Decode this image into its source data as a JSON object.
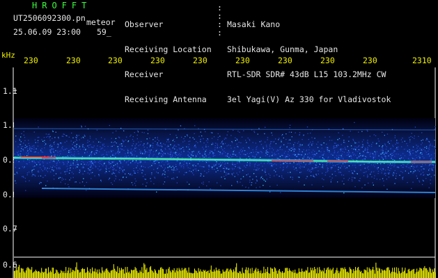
{
  "header": {
    "app_title": "HROFFT",
    "file_name": "UT2506092300.pn",
    "meteor_label": "meteor",
    "date_time": "25.06.09 23:00",
    "count": "59_",
    "info": [
      {
        "label": "Observer",
        "value": "Masaki Kano"
      },
      {
        "label": "Receiving Location",
        "value": "Shibukawa, Gunma, Japan"
      },
      {
        "label": "Receiver",
        "value": "RTL-SDR SDR# 43dB L15 103.2MHz CW"
      },
      {
        "label": "Receiving Antenna",
        "value": "3el Yagi(V) Az 330 for Vladivostok"
      }
    ]
  },
  "axis": {
    "unit": "kHz",
    "top_ticks": [
      "230",
      "230",
      "230",
      "230",
      "230",
      "230",
      "230",
      "230",
      "230",
      "2310"
    ],
    "y_ticks": [
      "1.1",
      "1.0",
      "0.9",
      "0.8",
      "0.7",
      "0.6"
    ]
  },
  "colors": {
    "text_green": "#3cff3c",
    "text_yellow": "#f0f000",
    "text_white": "#e6e6e6",
    "echo_band": "#3c8cff",
    "level_bars": "#ffff00"
  }
}
